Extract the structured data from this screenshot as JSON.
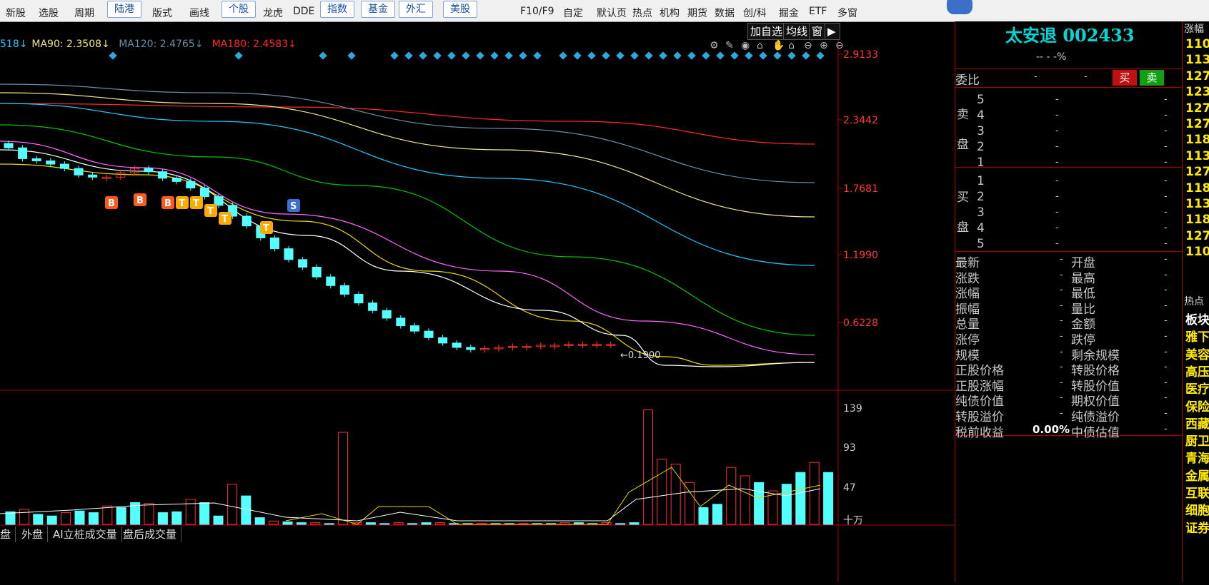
{
  "toolbar": {
    "items": [
      "新股",
      "选股",
      "周期",
      "陆港",
      "版式",
      "画线",
      "个股",
      "龙虎",
      "DDE",
      "指数",
      "基金",
      "外汇",
      "美股",
      "F10/F9",
      "自定",
      "默认页",
      "热点",
      "机构",
      "期货",
      "数据",
      "创/科",
      "掘金",
      "ETF",
      "多窗"
    ]
  },
  "chart_toolbar": {
    "add_watch": "加自选",
    "ma_line": "均线",
    "window": "窗"
  },
  "ma_legend": [
    {
      "text": "518↓",
      "color": "#1ec8ff"
    },
    {
      "text": "MA90: 2.3508↓",
      "color": "#f0e68c"
    },
    {
      "text": "MA120: 2.4765↓",
      "color": "#6a8fa8"
    },
    {
      "text": "MA180: 2.4583↓",
      "color": "#ff2828"
    }
  ],
  "price_axis": [
    "2.9133",
    "2.3442",
    "1.7681",
    "1.1990",
    "0.6228"
  ],
  "volume_axis": [
    "139",
    "93",
    "47"
  ],
  "volume_unit": "十万",
  "low_label": "0.1900",
  "signal_labels": [
    "B",
    "B",
    "B",
    "T",
    "T",
    "T",
    "T",
    "S",
    "T"
  ],
  "chart_data": {
    "type": "candlestick",
    "price_ylim": [
      0.19,
      2.9133
    ],
    "volume_ylim": [
      0,
      139
    ],
    "ma_series_colors": {
      "ma_short": "#ffffff",
      "ma_yellow": "#e8d800",
      "ma_pink": "#ff66ff",
      "ma_green": "#00c800",
      "ma_cyan": "#1ec8ff",
      "ma_light": "#f0e68c",
      "ma_steel": "#6a8fa8",
      "ma_red": "#ff2828"
    },
    "approx_close": [
      2.05,
      1.95,
      1.93,
      1.9,
      1.86,
      1.8,
      1.78,
      1.78,
      1.82,
      1.86,
      1.83,
      1.77,
      1.74,
      1.68,
      1.6,
      1.52,
      1.42,
      1.33,
      1.22,
      1.12,
      1.02,
      0.95,
      0.86,
      0.78,
      0.7,
      0.62,
      0.55,
      0.48,
      0.41,
      0.36,
      0.3,
      0.25,
      0.21,
      0.19,
      0.2,
      0.21,
      0.22,
      0.22,
      0.23,
      0.23,
      0.24,
      0.24,
      0.24,
      0.24
    ],
    "approx_volume": [
      15,
      18,
      12,
      10,
      14,
      16,
      14,
      22,
      20,
      26,
      25,
      14,
      15,
      30,
      26,
      10,
      48,
      34,
      8,
      4,
      3,
      2,
      2,
      1,
      110,
      2,
      2,
      1,
      2,
      1,
      2,
      2,
      1,
      1,
      1,
      1,
      1,
      1,
      1,
      1,
      2,
      2,
      1,
      2,
      1,
      2,
      137,
      78,
      72,
      50,
      20,
      24,
      68,
      58,
      50,
      40,
      48,
      62,
      74,
      62
    ]
  },
  "panel": {
    "title": "太安退 002433",
    "change": "-- - -%",
    "weibi_label": "委比",
    "weibi_val1": "-",
    "weibi_val2": "-",
    "buy_btn": "买",
    "sell_btn": "卖",
    "sell_label": [
      "卖",
      "盘"
    ],
    "buy_label": [
      "买",
      "盘"
    ],
    "levels": [
      "5",
      "4",
      "3",
      "2",
      "1",
      "1",
      "2",
      "3",
      "4",
      "5"
    ],
    "stats_left": [
      "最新",
      "涨跌",
      "涨幅",
      "振幅",
      "总量",
      "涨停",
      "规模",
      "正股价格",
      "正股涨幅",
      "纯债价值",
      "转股溢价",
      "税前收益"
    ],
    "stats_right": [
      "开盘",
      "最高",
      "最低",
      "量比",
      "金额",
      "跌停",
      "剩余规模",
      "转股价格",
      "转股价值",
      "期权价值",
      "纯债溢价",
      "中债估值"
    ],
    "pretax_yield": "0.00%",
    "dash": "-"
  },
  "strip": {
    "header": "涨幅",
    "codes": [
      "110",
      "113",
      "127",
      "123",
      "127",
      "127",
      "118",
      "113",
      "127",
      "118",
      "113",
      "118",
      "127",
      "110"
    ],
    "hot_header": "热点",
    "sectors": [
      "板块",
      "雅下",
      "美容",
      "高压",
      "医疗",
      "保险",
      "西藏",
      "厨卫",
      "青海",
      "金属",
      "互联",
      "细胞",
      "证券"
    ]
  },
  "bottom_tabs": [
    "盘",
    "外盘",
    "AI立桩成交量",
    "盘后成交量"
  ]
}
